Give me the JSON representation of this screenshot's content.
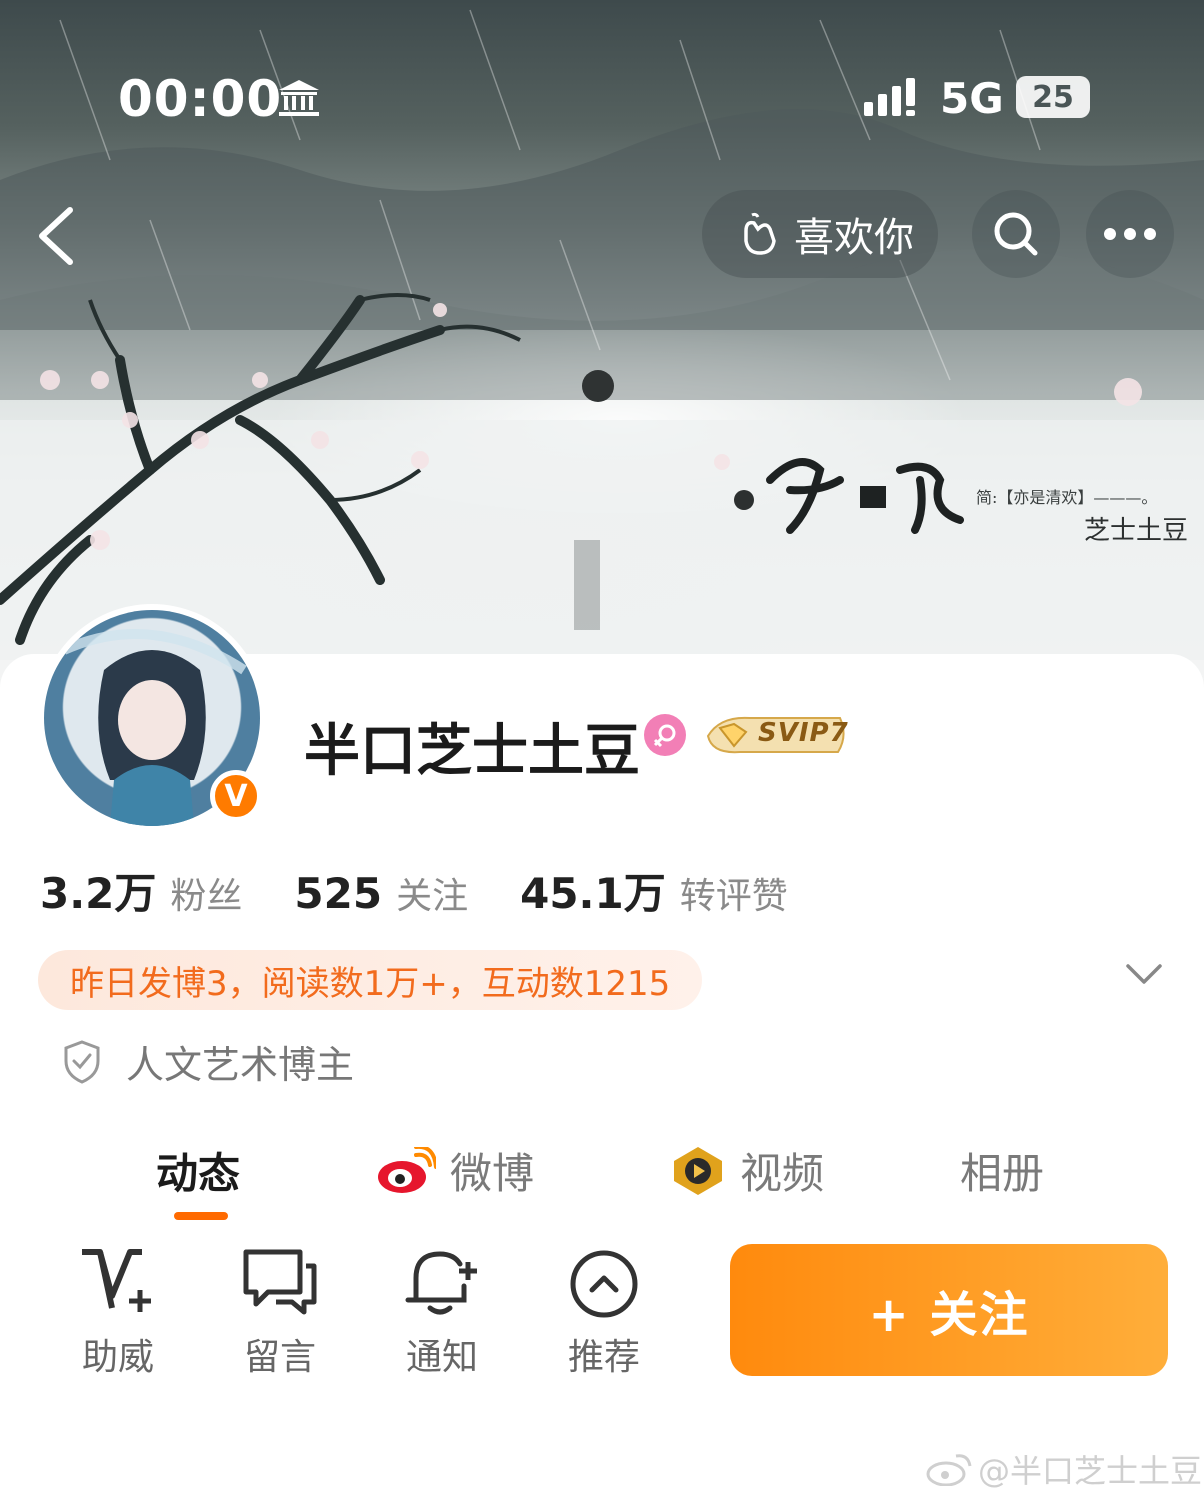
{
  "status_bar": {
    "time": "00:00",
    "network": "5G",
    "battery": "25"
  },
  "cover": {
    "like_label": "喜欢你",
    "signature": "芝士土豆",
    "subtitle": "简:【亦是清欢】———。"
  },
  "profile": {
    "name": "半口芝士土豆",
    "verified_mark": "V",
    "vip_badge": "SVIP7",
    "stats": [
      {
        "value": "3.2万",
        "label": "粉丝"
      },
      {
        "value": "525",
        "label": "关注"
      },
      {
        "value": "45.1万",
        "label": "转评赞"
      }
    ],
    "summary": "昨日发博3，阅读数1万+，互动数1215",
    "tag": "人文艺术博主"
  },
  "tabs": [
    {
      "label": "动态",
      "active": true
    },
    {
      "label": "微博",
      "active": false
    },
    {
      "label": "视频",
      "active": false
    },
    {
      "label": "相册",
      "active": false
    }
  ],
  "actions": [
    {
      "label": "助威",
      "icon": "v-plus-icon"
    },
    {
      "label": "留言",
      "icon": "message-icon"
    },
    {
      "label": "通知",
      "icon": "bell-plus-icon"
    },
    {
      "label": "推荐",
      "icon": "chevron-up-circle-icon"
    }
  ],
  "follow_button": "+ 关注",
  "watermark": "@半口芝士土豆",
  "colors": {
    "accent": "#ff7b00",
    "summary_text": "#f26b1d",
    "gender_badge": "#f27fb6"
  }
}
